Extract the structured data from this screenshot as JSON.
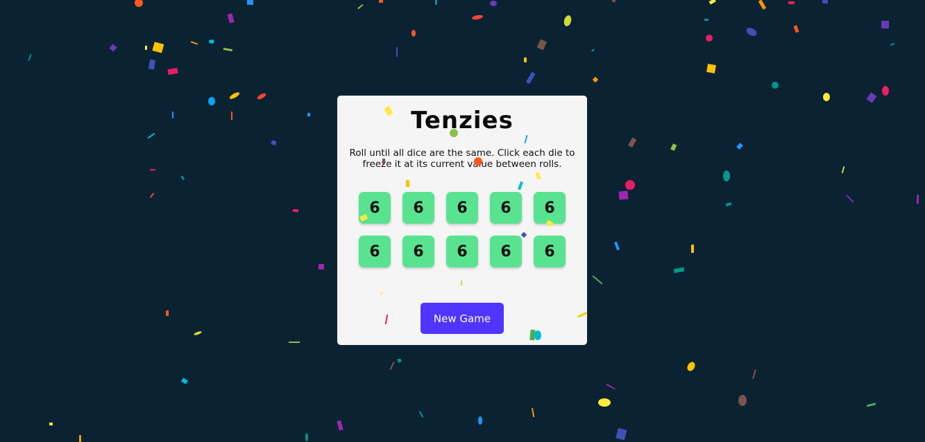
{
  "app": {
    "title": "Tenzies",
    "instructions": "Roll until all dice are the same. Click each die to freeze it at its current value between rolls.",
    "new_game_label": "New Game"
  },
  "dice": [
    {
      "value": "6",
      "held": true
    },
    {
      "value": "6",
      "held": true
    },
    {
      "value": "6",
      "held": true
    },
    {
      "value": "6",
      "held": true
    },
    {
      "value": "6",
      "held": true
    },
    {
      "value": "6",
      "held": true
    },
    {
      "value": "6",
      "held": true
    },
    {
      "value": "6",
      "held": true
    },
    {
      "value": "6",
      "held": true
    },
    {
      "value": "6",
      "held": true
    }
  ],
  "colors": {
    "background": "#0b2233",
    "card": "#f5f5f5",
    "held_die": "#59e391",
    "button": "#5035ff",
    "confetti": [
      "#ff5722",
      "#ffc107",
      "#e91e63",
      "#9c27b0",
      "#673ab7",
      "#3f51b5",
      "#2196f3",
      "#03a9f4",
      "#00bcd4",
      "#009688",
      "#4caf50",
      "#8bc34a",
      "#cddc39",
      "#ffeb3b",
      "#795548"
    ]
  },
  "state": {
    "won": true,
    "confetti_visible": true
  }
}
